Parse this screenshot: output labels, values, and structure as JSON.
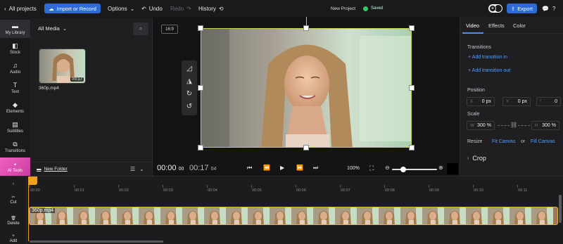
{
  "topbar": {
    "back_label": "All projects",
    "import_label": "Import or Record",
    "options_label": "Options",
    "undo_label": "Undo",
    "redo_label": "Redo",
    "history_label": "History",
    "project_name": "New Project",
    "save_status": "Saved",
    "export_label": "Export"
  },
  "rail": {
    "items": [
      {
        "label": "My Library",
        "icon": "folder-icon"
      },
      {
        "label": "Stock",
        "icon": "stock-icon"
      },
      {
        "label": "Audio",
        "icon": "music-note-icon"
      },
      {
        "label": "Text",
        "icon": "text-icon"
      },
      {
        "label": "Elements",
        "icon": "shapes-icon"
      },
      {
        "label": "Subtitles",
        "icon": "subtitles-icon"
      },
      {
        "label": "Transitions",
        "icon": "transitions-icon"
      }
    ],
    "ai_tools_label": "AI Tools"
  },
  "library": {
    "filter_label": "All Media",
    "media": [
      {
        "name": "360p.mp4",
        "duration": "00:17"
      }
    ],
    "new_folder_label": "New Folder"
  },
  "preview": {
    "aspect_ratio": "16:9",
    "current_time": "00:00",
    "current_frames": "00",
    "total_time": "00:17",
    "total_frames": "04",
    "zoom_level": "100%"
  },
  "inspector": {
    "tabs": [
      "Video",
      "Effects",
      "Color"
    ],
    "active_tab": "Video",
    "transitions_title": "Transitions",
    "add_in_label": "Add transition in",
    "add_out_label": "Add transition out",
    "position_title": "Position",
    "pos_x_label": "X",
    "pos_x": "0 px",
    "pos_y_label": "Y",
    "pos_y": "0 px",
    "rotation_label": "°",
    "rotation": "0",
    "scale_title": "Scale",
    "scale_w_label": "W",
    "scale_w": "300 %",
    "scale_h_label": "H",
    "scale_h": "300 %",
    "resize_title": "Resize",
    "fit_canvas_label": "Fit Canvas",
    "resize_or": "or",
    "fill_canvas_label": "Fill Canvas",
    "crop_label": "Crop"
  },
  "timeline": {
    "tools": [
      {
        "label": "",
        "icon": "chevron-right-icon"
      },
      {
        "label": "Cut",
        "icon": "scissors-icon"
      },
      {
        "label": "Delete",
        "icon": "trash-icon"
      },
      {
        "label": "Add",
        "icon": "add-icon"
      }
    ],
    "ticks": [
      "00:00",
      "00:01",
      "00:02",
      "00:03",
      "00:04",
      "00:05",
      "00:06",
      "00:07",
      "00:08",
      "00:09",
      "00:10",
      "00:11"
    ],
    "clip_name": "360p.mp4"
  },
  "colors": {
    "accent": "#2e6bd6",
    "ai_tools": "#e24bb4",
    "playhead": "#f0a020",
    "selection": "#c8d24a",
    "link": "#5b9cf6"
  }
}
